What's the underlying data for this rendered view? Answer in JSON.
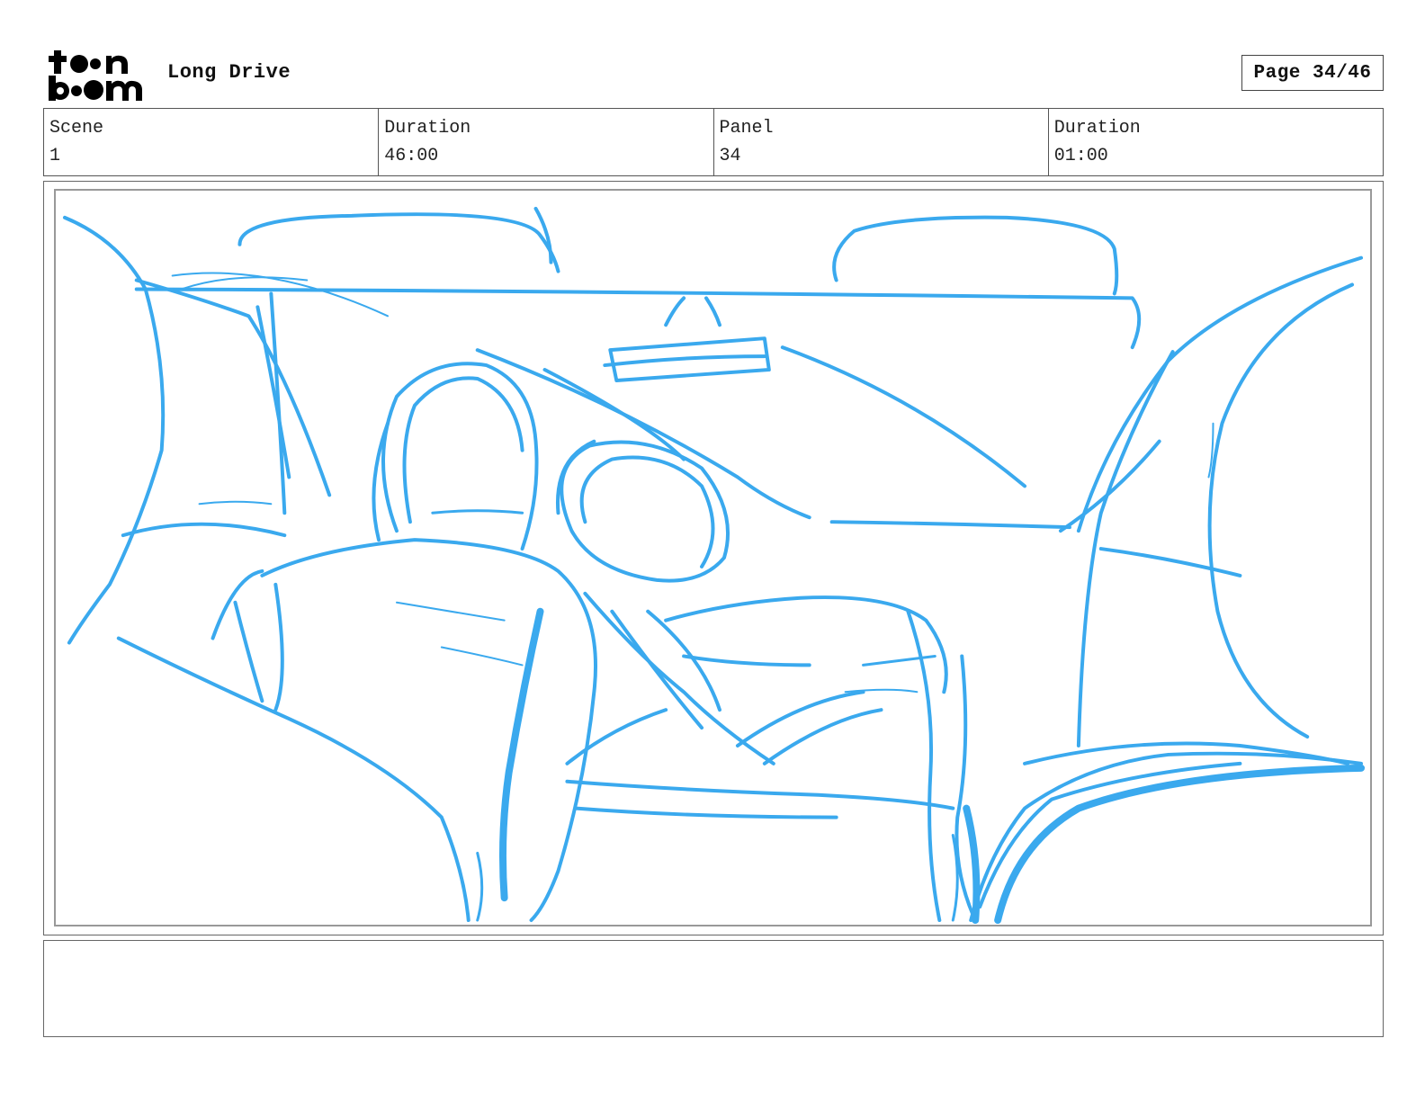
{
  "header": {
    "logo_icon": "toonboom-logo",
    "project_title": "Long Drive",
    "page_label": "Page 34/46"
  },
  "info": [
    {
      "label": "Scene",
      "value": "1"
    },
    {
      "label": "Duration",
      "value": "46:00"
    },
    {
      "label": "Panel",
      "value": "34"
    },
    {
      "label": "Duration",
      "value": "01:00"
    }
  ],
  "panel": {
    "image_icon": "sketch-car-interior-image",
    "sketch_color": "#3aa9ee"
  },
  "notes": {
    "text": ""
  }
}
